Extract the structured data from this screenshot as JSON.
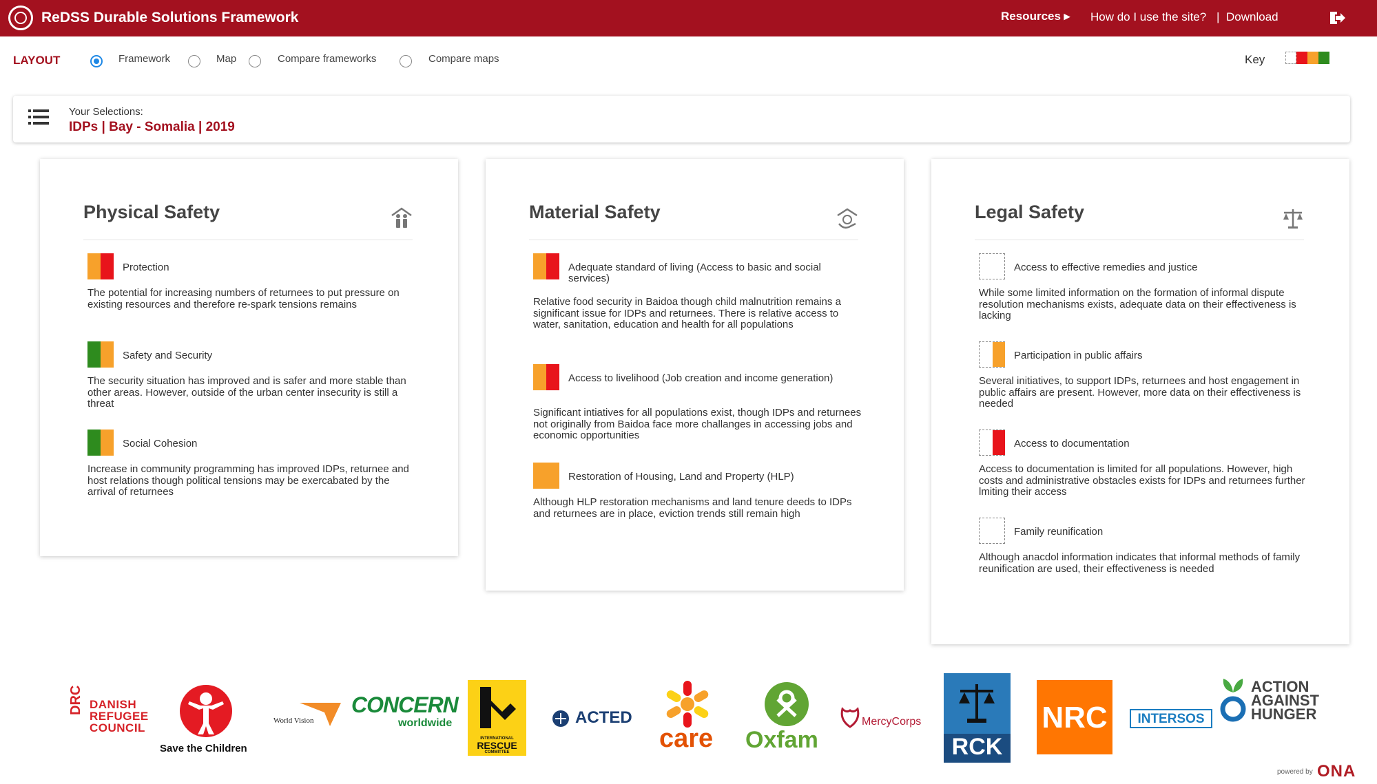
{
  "header": {
    "app_title": "ReDSS Durable Solutions Framework",
    "resources": "Resources ▸",
    "how_to": "How do I use the site?",
    "separator": "|",
    "download": "Download",
    "brand_color": "#a3111f"
  },
  "layout": {
    "label": "LAYOUT",
    "options": [
      {
        "label": "Framework",
        "selected": true
      },
      {
        "label": "Map",
        "selected": false
      },
      {
        "label": "Compare frameworks",
        "selected": false
      },
      {
        "label": "Compare maps",
        "selected": false
      }
    ],
    "key_label": "Key",
    "key_colors": [
      "#ffffff",
      "#e8141b",
      "#f7a12b",
      "#2e8b1e"
    ]
  },
  "selections": {
    "title": "Your Selections:",
    "value": "IDPs | Bay - Somalia | 2019"
  },
  "cards": [
    {
      "title": "Physical Safety",
      "icon": "family-icon",
      "items": [
        {
          "label": "Protection",
          "rating": [
            "orange",
            "red"
          ],
          "desc": "The potential for increasing numbers of returnees to put pressure on existing resources and therefore re-spark tensions remains"
        },
        {
          "label": "Safety and Security",
          "rating": [
            "green",
            "orange"
          ],
          "desc": "The security situation has improved and is safer and more stable than other areas. However, outside of the urban center insecurity is still a threat"
        },
        {
          "label": "Social Cohesion",
          "rating": [
            "green",
            "orange"
          ],
          "desc": "Increase in community programming has improved IDPs, returnee and host relations though political tensions may be exercabated by the arrival of returnees"
        }
      ]
    },
    {
      "title": "Material Safety",
      "icon": "shelter-hands-icon",
      "items": [
        {
          "label": "Adequate standard of living (Access to basic and social services)",
          "rating": [
            "orange",
            "red"
          ],
          "desc": "Relative food security in Baidoa though child malnutrition remains a significant issue for IDPs and returnees. There is relative access to water, sanitation, education and health for all populations"
        },
        {
          "label": "Access to livelihood (Job creation and income generation)",
          "rating": [
            "orange",
            "red"
          ],
          "desc": "Significant intiatives for all populations exist, though IDPs and returnees not originally from Baidoa face more challanges in accessing jobs and economic opportunities"
        },
        {
          "label": "Restoration of Housing, Land and Property (HLP)",
          "rating": [
            "orange"
          ],
          "desc": "Although HLP restoration mechanisms and land tenure deeds to IDPs and returnees are in place, eviction trends still remain high"
        }
      ]
    },
    {
      "title": "Legal Safety",
      "icon": "scales-icon",
      "items": [
        {
          "label": "Access to effective remedies and justice",
          "rating": [
            "white"
          ],
          "desc": "While some limited information on the formation of informal dispute resolution mechanisms exists, adequate data on their effectiveness is lacking"
        },
        {
          "label": "Participation in public affairs",
          "rating": [
            "white",
            "orange"
          ],
          "desc": "Several initiatives, to support IDPs, returnees and host engagement in public affairs are present. However, more data on their effectiveness is needed"
        },
        {
          "label": "Access to documentation",
          "rating": [
            "white",
            "red"
          ],
          "desc": "Access to documentation is limited for all populations. However, high costs and administrative obstacles exists for IDPs and returnees further lmiting their access"
        },
        {
          "label": "Family reunification",
          "rating": [
            "white"
          ],
          "desc": "Although anacdol information indicates that informal methods of family reunification are used, their effectiveness is needed"
        }
      ]
    }
  ],
  "partners": {
    "drc": [
      "DRC",
      "DANISH",
      "REFUGEE",
      "COUNCIL"
    ],
    "save": "Save the Children",
    "worldvision": "World Vision",
    "concern": [
      "CONCERN",
      "worldwide"
    ],
    "irc": [
      "INTERNATIONAL",
      "RESCUE",
      "COMMITTEE"
    ],
    "acted": "ACTED",
    "care": "care",
    "oxfam": "Oxfam",
    "mercy": "MercyCorps",
    "rck": "RCK",
    "nrc": "NRC",
    "intersos": "INTERSOS",
    "aah": [
      "ACTION",
      "AGAINST",
      "HUNGER"
    ]
  },
  "footer": {
    "powered": "powered by",
    "ona": "ONA"
  }
}
